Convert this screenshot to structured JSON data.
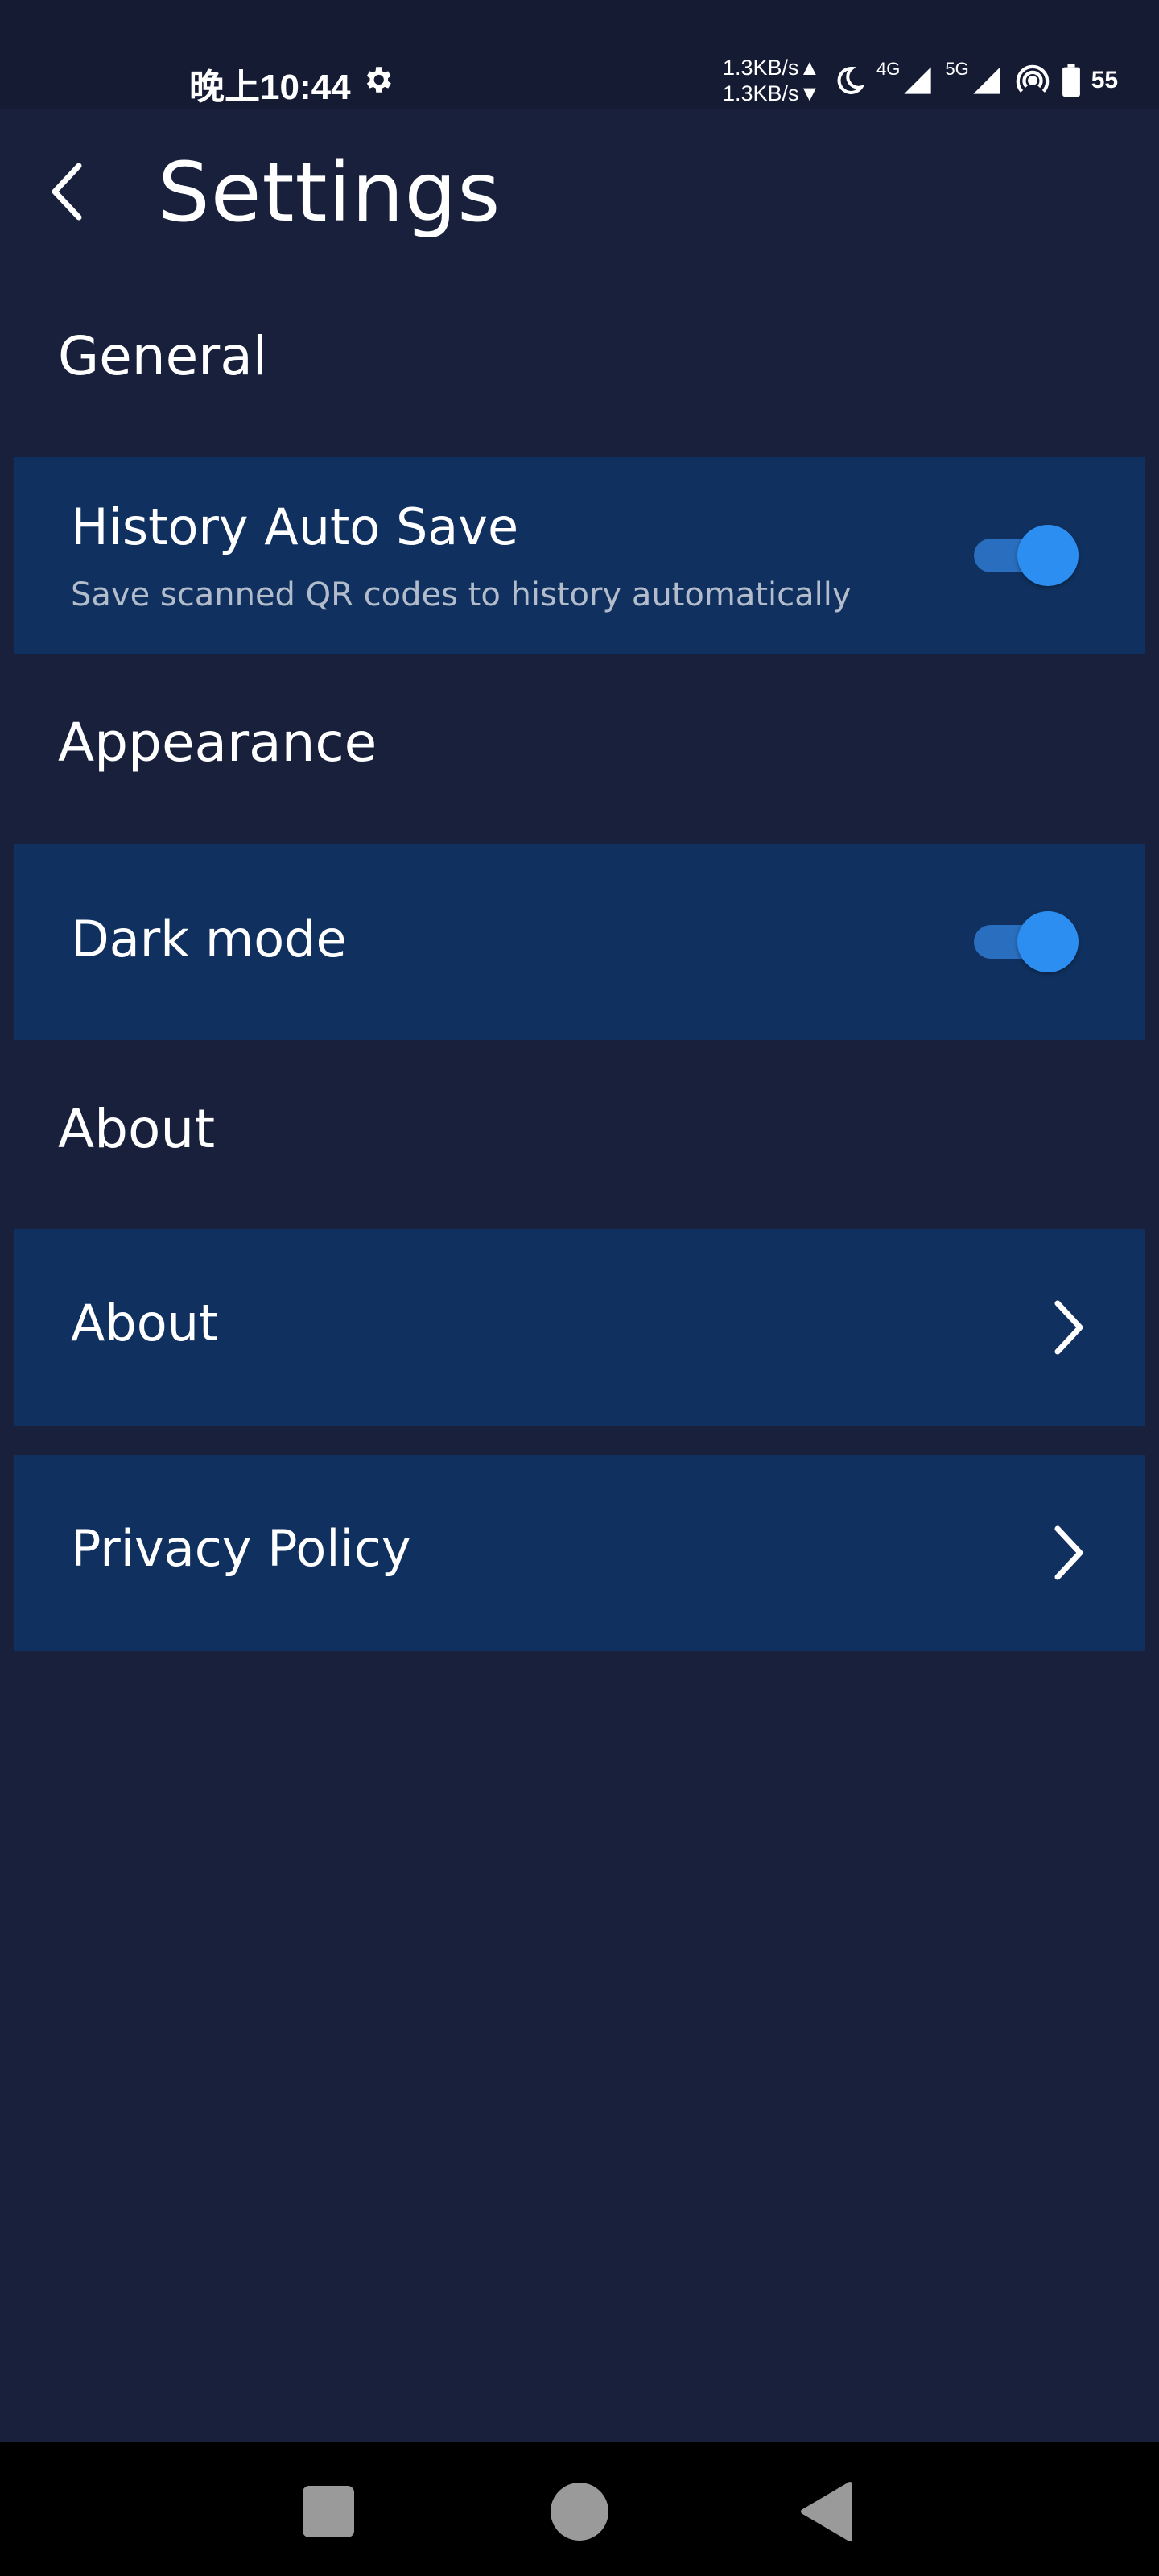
{
  "status_bar": {
    "time": "晚上10:44",
    "net_up": "1.3KB/s▲",
    "net_down": "1.3KB/s▼",
    "net_4g": "4G",
    "net_5g": "5G",
    "battery": "55"
  },
  "header": {
    "title": "Settings"
  },
  "sections": {
    "general": {
      "header": "General",
      "history_auto_save": {
        "title": "History Auto Save",
        "subtitle": "Save scanned QR codes to history automatically",
        "enabled": true
      }
    },
    "appearance": {
      "header": "Appearance",
      "dark_mode": {
        "title": "Dark mode",
        "enabled": true
      }
    },
    "about": {
      "header": "About",
      "about_item": {
        "title": "About"
      },
      "privacy_item": {
        "title": "Privacy Policy"
      }
    }
  },
  "icons": {
    "back": "back-arrow-icon",
    "chevron": "chevron-right-icon",
    "settings_gear": "gear-icon"
  },
  "colors": {
    "background": "#18203c",
    "card": "#103160",
    "toggle_on": "#2d8ef1",
    "subtitle": "#b3bccb"
  }
}
